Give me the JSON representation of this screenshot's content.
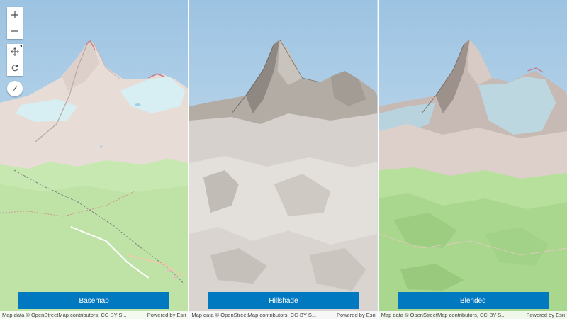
{
  "panels": [
    {
      "id": "basemap",
      "label": "Basemap"
    },
    {
      "id": "hillshade",
      "label": "Hillshade"
    },
    {
      "id": "blended",
      "label": "Blended"
    }
  ],
  "attribution": {
    "text": "Map data © OpenStreetMap contributors, CC-BY-S...",
    "powered_by": "Powered by Esri"
  },
  "nav_controls": {
    "zoom_in": "zoom-in-icon",
    "zoom_out": "zoom-out-icon",
    "pan": "pan-icon",
    "rotate": "rotate-icon",
    "compass": "compass-icon"
  },
  "colors": {
    "button": "#0079c1",
    "sky": "#cfe3f2",
    "vegetation": "#b6e09c",
    "rock": "#a69e96",
    "glacier": "#d7eef3"
  }
}
